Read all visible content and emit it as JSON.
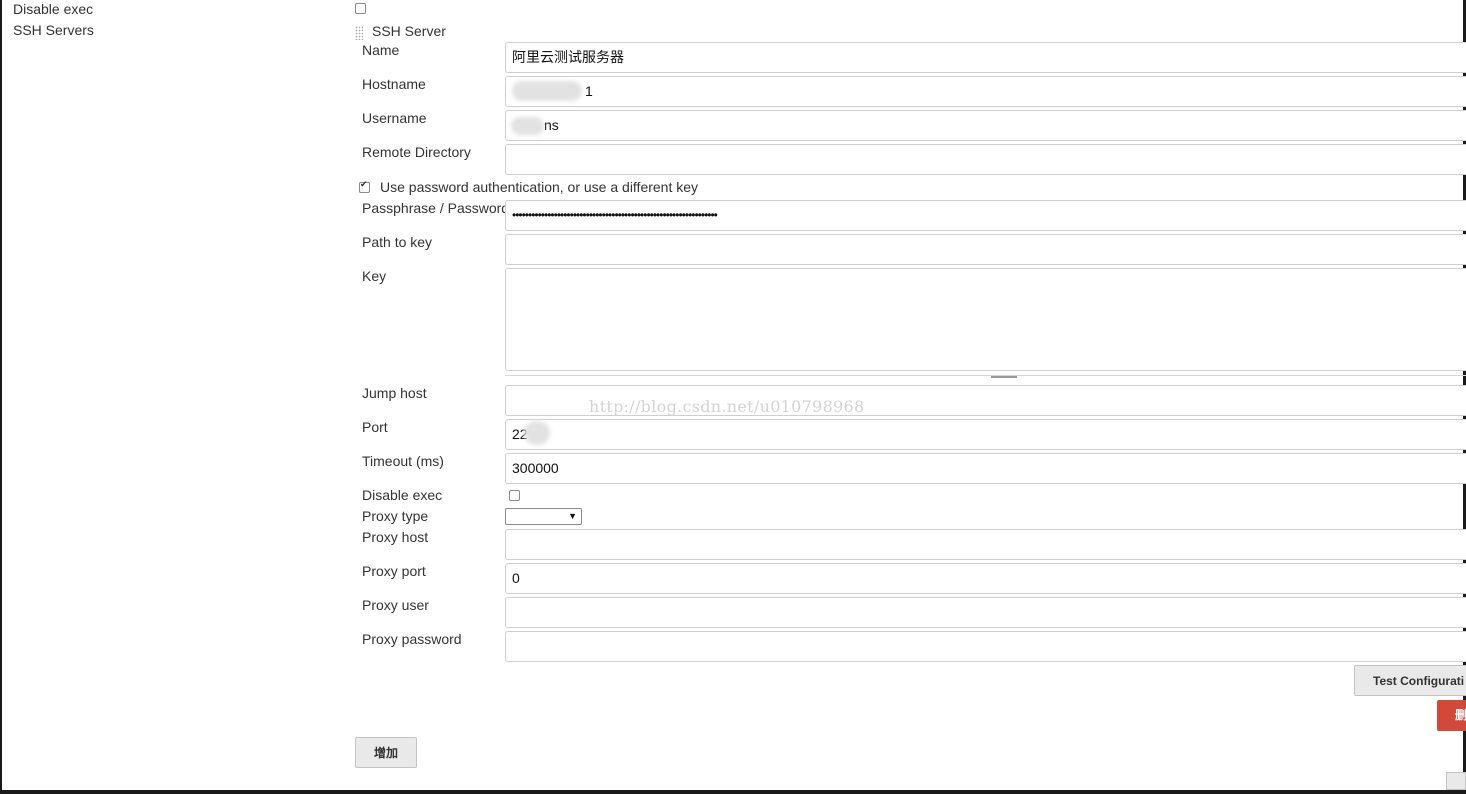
{
  "outer": {
    "disable_exec_label": "Disable exec",
    "ssh_servers_label": "SSH Servers"
  },
  "server": {
    "section_title": "SSH Server",
    "fields": {
      "name_label": "Name",
      "name_value": "阿里云测试服务器",
      "hostname_label": "Hostname",
      "hostname_value": "1",
      "username_label": "Username",
      "username_value": "ns",
      "remote_dir_label": "Remote Directory",
      "remote_dir_value": "",
      "use_password_label": "Use password authentication, or use a different key",
      "use_password_checked": true,
      "passphrase_label": "Passphrase / Password",
      "passphrase_value": "••••••••••••••••••••••••••••••••••••••••••••••••••••••••••••••••",
      "path_to_key_label": "Path to key",
      "path_to_key_value": "",
      "key_label": "Key",
      "key_value": "",
      "jump_host_label": "Jump host",
      "jump_host_value": "",
      "port_label": "Port",
      "port_value": "22",
      "timeout_label": "Timeout (ms)",
      "timeout_value": "300000",
      "disable_exec_label": "Disable exec",
      "disable_exec_checked": false,
      "proxy_type_label": "Proxy type",
      "proxy_type_value": "",
      "proxy_host_label": "Proxy host",
      "proxy_host_value": "",
      "proxy_port_label": "Proxy port",
      "proxy_port_value": "0",
      "proxy_user_label": "Proxy user",
      "proxy_user_value": "",
      "proxy_password_label": "Proxy password",
      "proxy_password_value": ""
    },
    "test_button_label": "Test Configurati",
    "delete_button_label": "删"
  },
  "add_button_label": "增加",
  "watermark": "http://blog.csdn.net/u010798968",
  "colors": {
    "delete_button": "#d24939",
    "button_gray": "#e9e9e9",
    "input_border": "#cfcfcf",
    "frame": "#1a1a1a"
  }
}
